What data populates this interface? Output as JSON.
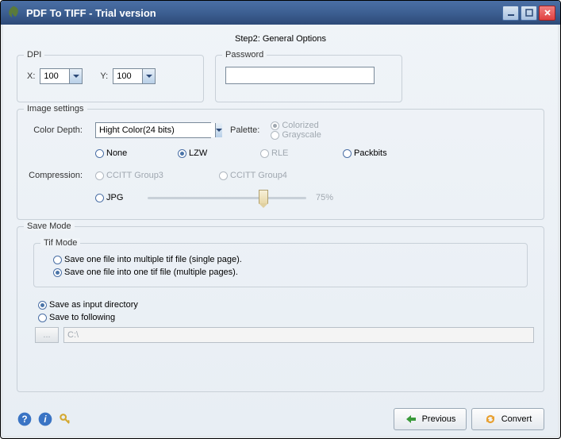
{
  "window": {
    "title": "PDF To TIFF - Trial version"
  },
  "step": "Step2: General Options",
  "dpi": {
    "legend": "DPI",
    "x_label": "X:",
    "x_value": "100",
    "y_label": "Y:",
    "y_value": "100"
  },
  "password": {
    "legend": "Password",
    "value": ""
  },
  "image": {
    "legend": "Image settings",
    "color_depth_label": "Color Depth:",
    "color_depth_value": "Hight Color(24 bits)",
    "palette_label": "Palette:",
    "palette_colorized": "Colorized",
    "palette_grayscale": "Grayscale",
    "compression_label": "Compression:",
    "none": "None",
    "lzw": "LZW",
    "rle": "RLE",
    "packbits": "Packbits",
    "ccitt3": "CCITT Group3",
    "ccitt4": "CCITT Group4",
    "jpg": "JPG",
    "jpg_pct": "75%"
  },
  "save": {
    "legend": "Save Mode",
    "tif_legend": "Tif Mode",
    "single": "Save one file into multiple tif file (single page).",
    "multi": "Save one file into one tif file (multiple pages).",
    "as_input": "Save as input directory",
    "to_following": "Save to following",
    "browse": "...",
    "path": "C:\\"
  },
  "footer": {
    "previous": "Previous",
    "convert": "Convert"
  }
}
